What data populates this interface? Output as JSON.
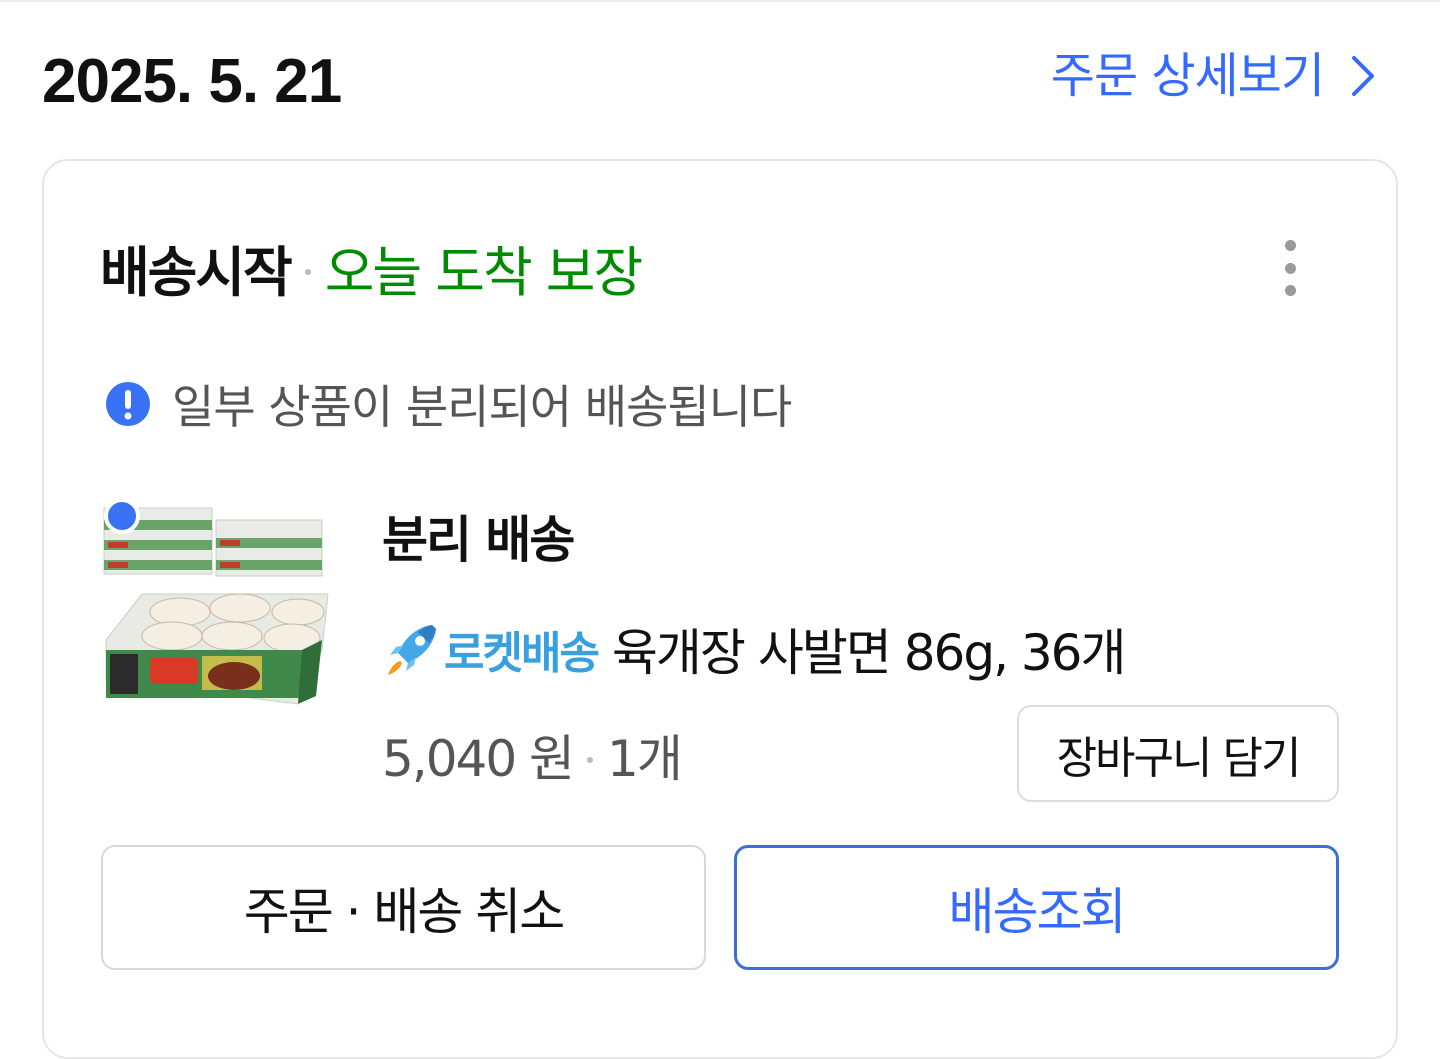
{
  "header": {
    "date": "2025. 5. 21",
    "detail_link": "주문 상세보기",
    "detail_icon": "chevron-right-icon"
  },
  "order": {
    "status": "배송시작",
    "status_sub": "오늘 도착 보장",
    "status_sub_color": "#008c00",
    "more_icon": "more-vertical-icon",
    "notice_icon": "exclamation-circle-icon",
    "notice": "일부 상품이 분리되어 배송됩니다",
    "shipment_title": "분리 배송",
    "item": {
      "rocket_label": "로켓배송",
      "rocket_icon": "rocket-icon",
      "name": "육개장 사발면 86g, 36개",
      "price": "5,040 원",
      "quantity": "1개",
      "cart_button": "장바구니 담기"
    },
    "buttons": {
      "cancel": "주문 · 배송 취소",
      "track": "배송조회"
    }
  },
  "colors": {
    "accent": "#346aff",
    "rocket": "#39a0e0",
    "badge": "#3a72f5"
  }
}
